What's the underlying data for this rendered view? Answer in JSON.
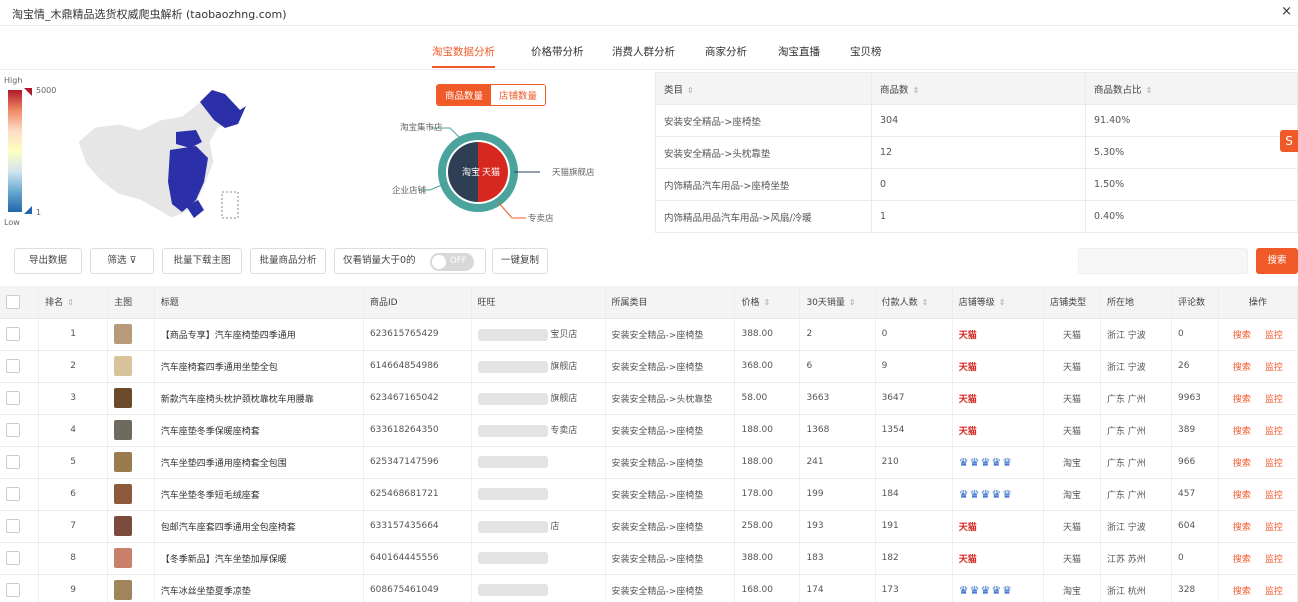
{
  "window": {
    "title": "淘宝情_木鼎精品选货权威爬虫解析 (taobaozhng.com)",
    "close": "×"
  },
  "tabs": [
    {
      "label": "淘宝数据分析"
    },
    {
      "label": "价格带分析"
    },
    {
      "label": "消费人群分析"
    },
    {
      "label": "商家分析"
    },
    {
      "label": "淘宝直播"
    },
    {
      "label": "宝贝榜"
    }
  ],
  "map": {
    "legend_high": "High",
    "legend_low": "Low",
    "legend_max": "5000",
    "legend_min": "1"
  },
  "donut": {
    "toggle_on": "商品数量",
    "toggle_off": "店铺数量",
    "center_left": "淘宝",
    "center_right": "天猫",
    "callouts": [
      "淘宝集市店",
      "企业店铺",
      "天猫旗舰店",
      "专卖店"
    ],
    "colors": {
      "tmall": "#d6281f",
      "taobao": "#2d3e55",
      "ring_outer": "#4aa39c"
    }
  },
  "shop_table": {
    "headers": [
      "类目",
      "商品数",
      "商品数占比"
    ],
    "rows": [
      [
        "安装安全精品->座椅垫",
        "304",
        "91.40%"
      ],
      [
        "安装安全精品->头枕靠垫",
        "12",
        "5.30%"
      ],
      [
        "内饰精品汽车用品->座椅坐垫",
        "0",
        "1.50%"
      ],
      [
        "内饰精品用品汽车用品->风扇/冷暖",
        "1",
        "0.40%"
      ]
    ]
  },
  "toolbar": {
    "export": "导出数据",
    "filter": "筛选",
    "filter_icon": "filter-icon",
    "bulk_images": "批量下载主图",
    "bulk_sku": "批量商品分析",
    "toggle_label": "仅看销量大于0的",
    "toggle_state": "OFF",
    "one_click": "一键复制",
    "search_btn": "搜索"
  },
  "product_table": {
    "headers": [
      "排名",
      "主图",
      "标题",
      "商品ID",
      "旺旺",
      "所属类目",
      "价格",
      "30天销量",
      "付款人数",
      "店铺等级",
      "店铺类型",
      "所在地",
      "评论数",
      "操作"
    ],
    "rows": [
      {
        "rank": "1",
        "title": "【商品专享】汽车座椅垫四季通用",
        "id": "623615765429",
        "ww": "宝贝店",
        "cat": "安装安全精品->座椅垫",
        "price": "388.00",
        "sales": "2",
        "buyers": "0",
        "level": "天猫",
        "type": "天猫",
        "loc": "浙江 宁波",
        "reviews": "0",
        "color": "#b89a7a"
      },
      {
        "rank": "2",
        "title": "汽车座椅套四季通用坐垫全包",
        "id": "614664854986",
        "ww": "旗舰店",
        "cat": "安装安全精品->座椅垫",
        "price": "368.00",
        "sales": "6",
        "buyers": "9",
        "level": "天猫",
        "type": "天猫",
        "loc": "浙江 宁波",
        "reviews": "26",
        "color": "#d8c39a"
      },
      {
        "rank": "3",
        "title": "新款汽车座椅头枕护颈枕靠枕车用腰靠",
        "id": "623467165042",
        "ww": "旗舰店",
        "cat": "安装安全精品->头枕靠垫",
        "price": "58.00",
        "sales": "3663",
        "buyers": "3647",
        "level": "天猫",
        "type": "天猫",
        "loc": "广东 广州",
        "reviews": "9963",
        "color": "#6b4a2a"
      },
      {
        "rank": "4",
        "title": "汽车座垫冬季保暖座椅套",
        "id": "633618264350",
        "ww": "专卖店",
        "cat": "安装安全精品->座椅垫",
        "price": "188.00",
        "sales": "1368",
        "buyers": "1354",
        "level": "天猫",
        "type": "天猫",
        "loc": "广东 广州",
        "reviews": "389",
        "color": "#6f6a5e"
      },
      {
        "rank": "5",
        "title": "汽车坐垫四季通用座椅套全包围",
        "id": "625347147596",
        "ww": "",
        "cat": "安装安全精品->座椅垫",
        "price": "188.00",
        "sales": "241",
        "buyers": "210",
        "level": "crown",
        "type": "淘宝",
        "loc": "广东 广州",
        "reviews": "966",
        "color": "#9a7b4f"
      },
      {
        "rank": "6",
        "title": "汽车坐垫冬季短毛绒座套",
        "id": "625468681721",
        "ww": "",
        "cat": "安装安全精品->座椅垫",
        "price": "178.00",
        "sales": "199",
        "buyers": "184",
        "level": "crown",
        "type": "淘宝",
        "loc": "广东 广州",
        "reviews": "457",
        "color": "#8a5a3a"
      },
      {
        "rank": "7",
        "title": "包邮汽车座套四季通用全包座椅套",
        "id": "633157435664",
        "ww": "店",
        "cat": "安装安全精品->座椅垫",
        "price": "258.00",
        "sales": "193",
        "buyers": "191",
        "level": "天猫",
        "type": "天猫",
        "loc": "浙江 宁波",
        "reviews": "604",
        "color": "#7a4a3a"
      },
      {
        "rank": "8",
        "title": "【冬季新品】汽车坐垫加厚保暖",
        "id": "640164445556",
        "ww": "",
        "cat": "安装安全精品->座椅垫",
        "price": "388.00",
        "sales": "183",
        "buyers": "182",
        "level": "天猫",
        "type": "天猫",
        "loc": "江苏 苏州",
        "reviews": "0",
        "color": "#c8806a"
      },
      {
        "rank": "9",
        "title": "汽车冰丝坐垫夏季凉垫",
        "id": "608675461049",
        "ww": "",
        "cat": "安装安全精品->座椅垫",
        "price": "168.00",
        "sales": "174",
        "buyers": "173",
        "level": "crown",
        "type": "淘宝",
        "loc": "浙江 杭州",
        "reviews": "328",
        "color": "#a0845c"
      }
    ],
    "action_view": "搜索",
    "action_analyze": "监控"
  }
}
